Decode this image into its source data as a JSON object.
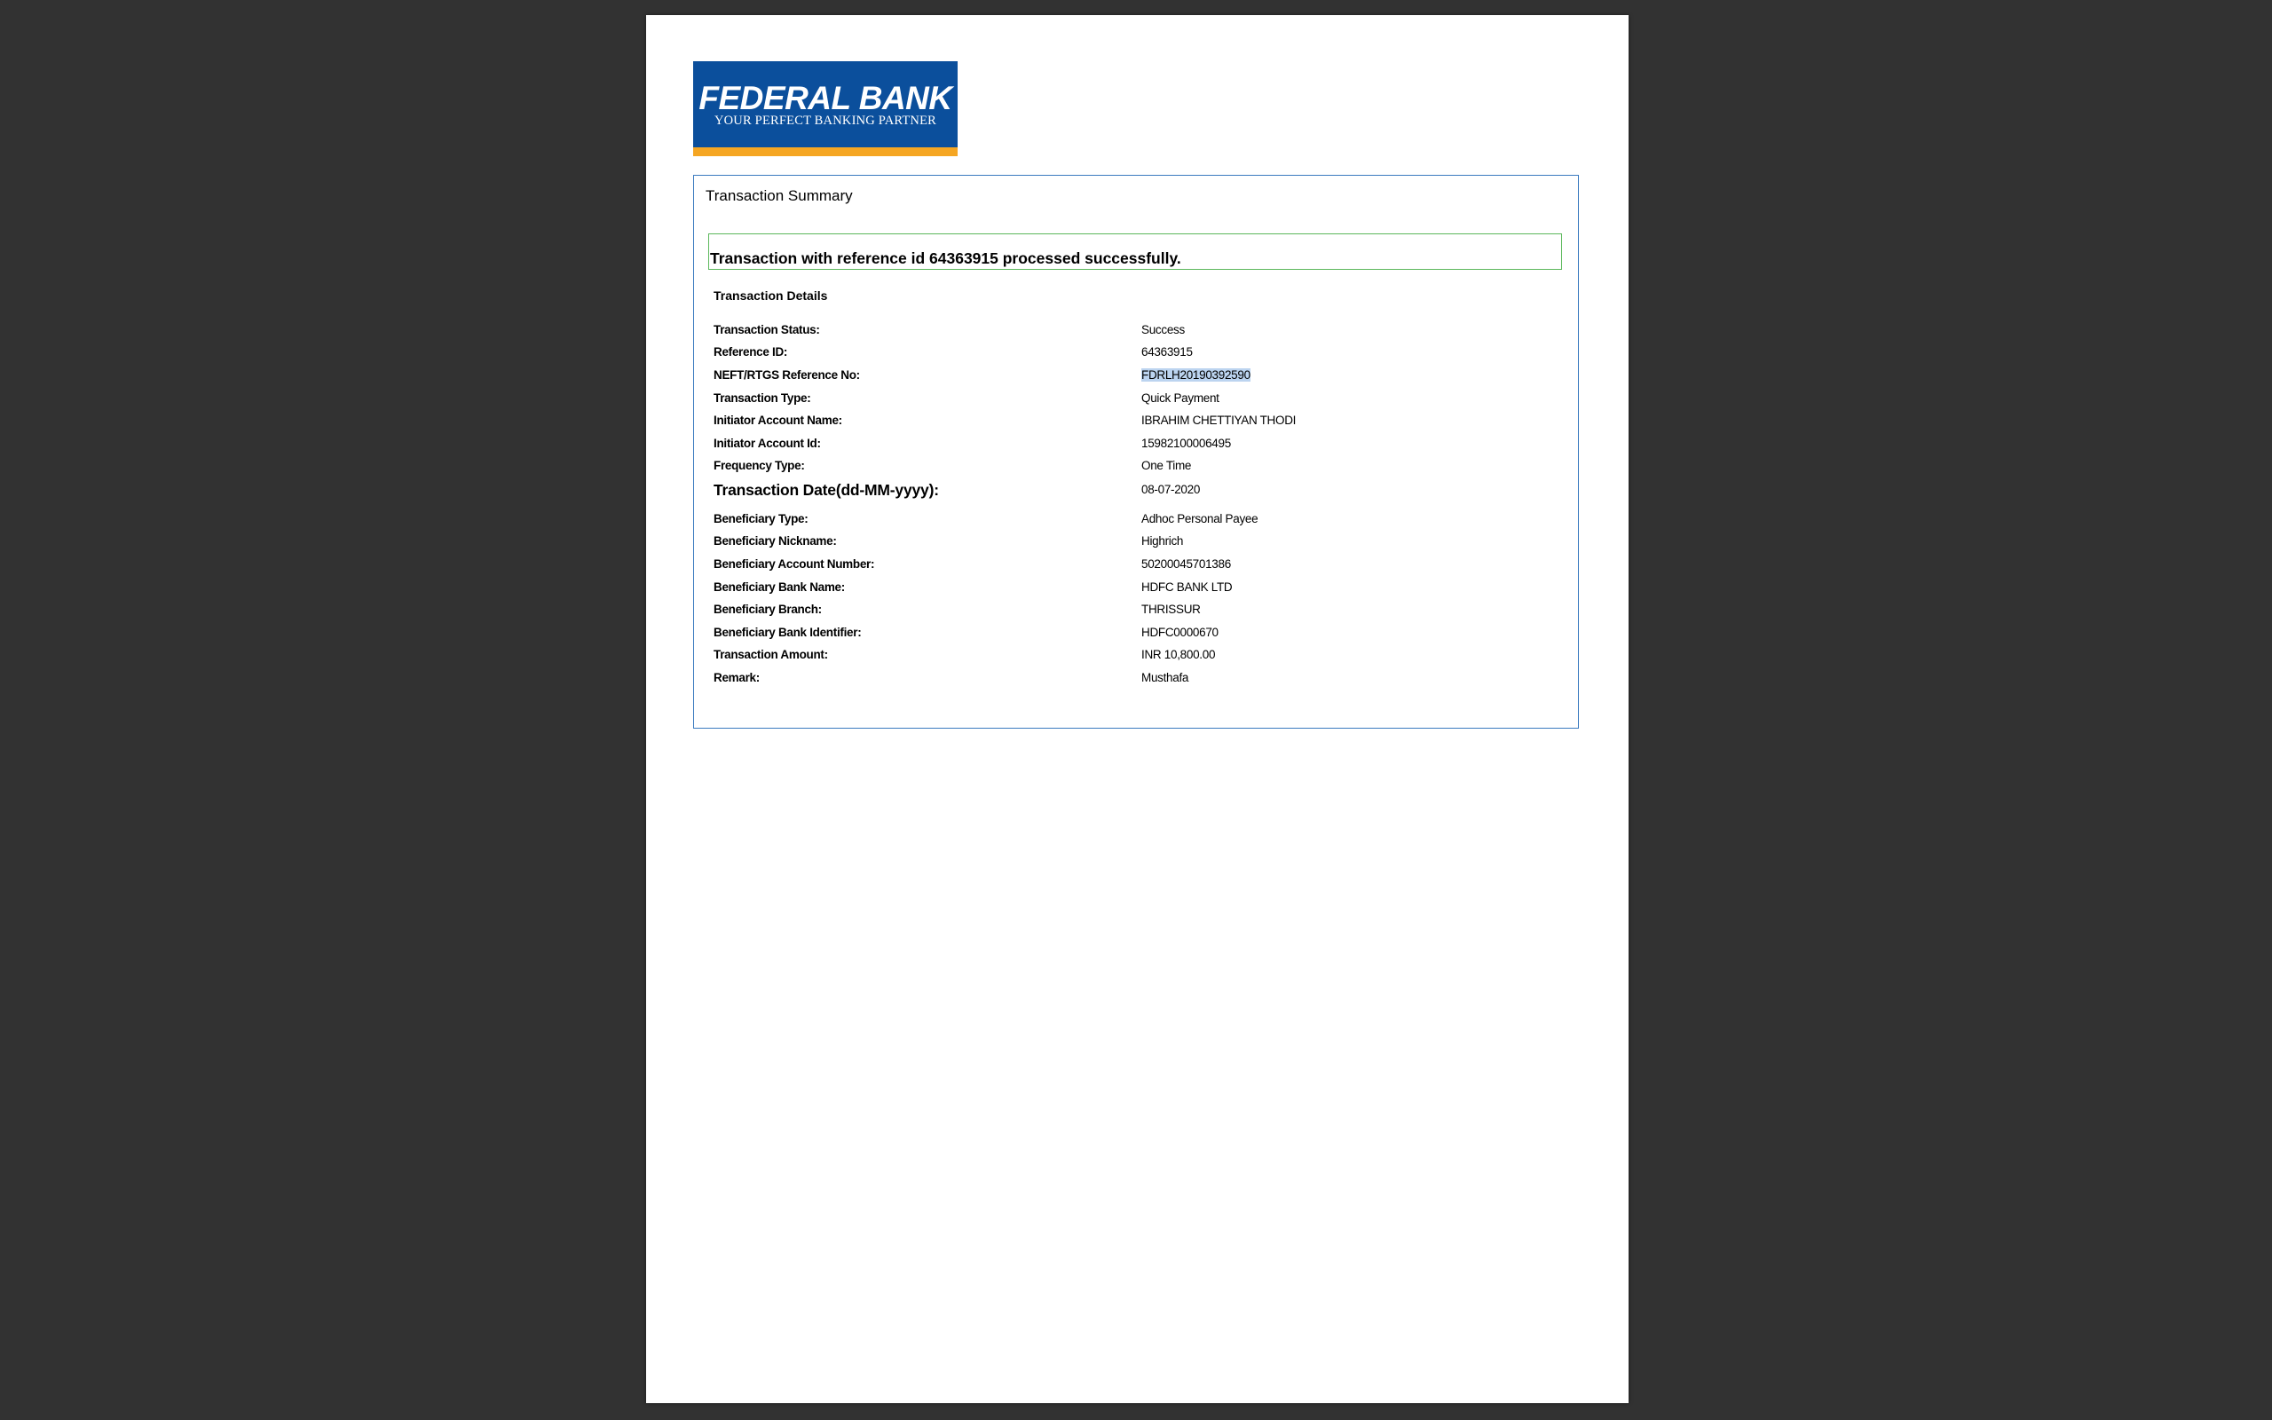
{
  "colors": {
    "viewer_background": "#323232",
    "page_background": "#ffffff",
    "logo_blue": "#0b4f9c",
    "logo_orange": "#f5a623",
    "box_border": "#3a7abf",
    "success_border": "#5cb85c",
    "selection": "#bcd4f0"
  },
  "logo": {
    "name": "FEDERAL BANK",
    "tagline": "YOUR PERFECT BANKING PARTNER"
  },
  "summary": {
    "title": "Transaction Summary",
    "success_message": "Transaction with reference id 64363915 processed successfully.",
    "details_heading": "Transaction Details",
    "rows": [
      {
        "label": "Transaction Status:",
        "value": "Success"
      },
      {
        "label": "Reference ID:",
        "value": "64363915"
      },
      {
        "label": "NEFT/RTGS Reference No:",
        "value": "FDRLH20190392590"
      },
      {
        "label": "Transaction Type:",
        "value": "Quick Payment"
      },
      {
        "label": "Initiator Account Name:",
        "value": "IBRAHIM CHETTIYAN THODI"
      },
      {
        "label": "Initiator Account Id:",
        "value": "15982100006495"
      },
      {
        "label": "Frequency Type:",
        "value": "One Time"
      },
      {
        "label": "Transaction Date(dd-MM-yyyy):",
        "value": "08-07-2020"
      },
      {
        "label": "Beneficiary Type:",
        "value": "Adhoc Personal Payee"
      },
      {
        "label": "Beneficiary Nickname:",
        "value": "Highrich"
      },
      {
        "label": "Beneficiary Account Number:",
        "value": "50200045701386"
      },
      {
        "label": "Beneficiary Bank Name:",
        "value": "HDFC BANK LTD"
      },
      {
        "label": "Beneficiary Branch:",
        "value": "THRISSUR"
      },
      {
        "label": "Beneficiary Bank Identifier:",
        "value": "HDFC0000670"
      },
      {
        "label": "Transaction Amount:",
        "value": "INR 10,800.00"
      },
      {
        "label": "Remark:",
        "value": "Musthafa"
      }
    ]
  }
}
